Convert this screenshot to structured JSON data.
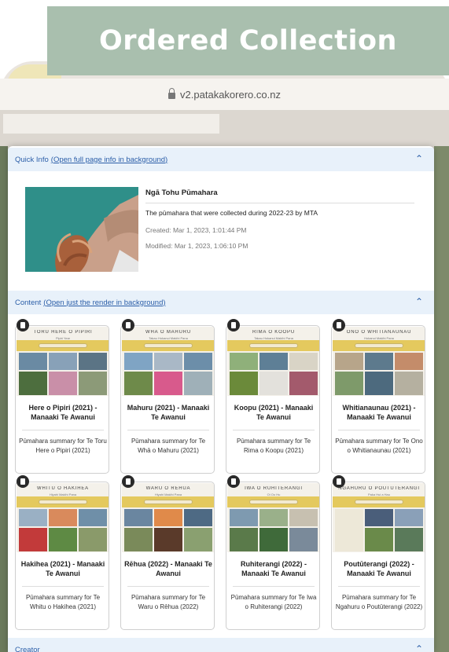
{
  "banner": {
    "title": "Ordered Collection"
  },
  "browser": {
    "url": "v2.patakakorero.co.nz"
  },
  "quick_info": {
    "header_label": "Quick Info",
    "header_link": "(Open full page info in background)",
    "title": "Ngā Tohu Pūmahara",
    "description": "The pūmahara that were collected during 2022-23 by MTA",
    "created": "Created: Mar 1, 2023, 1:01:44 PM",
    "modified": "Modified: Mar 1, 2023, 1:06:10 PM"
  },
  "content": {
    "header_label": "Content",
    "header_link": "(Open just the render in background)",
    "items": [
      {
        "thumb_title": "Toru Here o Pipiri",
        "thumb_sub": "Pipiri Year",
        "title": "Here o Pipiri (2021) - Manaaki Te Awanui",
        "description": "Pūmahara summary for Te Toru Here o Pipiri (2021)"
      },
      {
        "thumb_title": "Whā o Mahuru",
        "thumb_sub": "Takau Hokanui Makihi Pana",
        "title": "Mahuru (2021) - Manaaki Te Awanui",
        "description": "Pūmahara summary for Te Whā o Mahuru (2021)"
      },
      {
        "thumb_title": "Rima o Koopu",
        "thumb_sub": "Takau Hokanui Makihi Pana",
        "title": "Koopu (2021) - Manaaki Te Awanui",
        "description": "Pūmahara summary for Te Rima o Koopu (2021)"
      },
      {
        "thumb_title": "Ono o Whitianaunau",
        "thumb_sub": "Hokanui Makihi Pana",
        "title": "Whitianaunau (2021) - Manaaki Te Awanui",
        "description": "Pūmahara summary for Te Ono o Whitianaunau (2021)"
      },
      {
        "thumb_title": "Whitu o Hakihea",
        "thumb_sub": "Hiyahi Makihi Pana",
        "title": "Hakihea (2021) - Manaaki Te Awanui",
        "description": "Pūmahara summary for Te Whitu o Hakihea (2021)"
      },
      {
        "thumb_title": "Waru o Rēhua",
        "thumb_sub": "Hiyahi Makihi Pana",
        "title": "Rēhua (2022) - Manaaki Te Awanui",
        "description": "Pūmahara summary for Te Waru o Rēhua (2022)"
      },
      {
        "thumb_title": "Iwa o Ruhiterangi",
        "thumb_sub": "Oi Oo Hu",
        "title": "Ruhiterangi (2022) - Manaaki Te Awanui",
        "description": "Pūmahara summary for Te Iwa o Ruhiterangi (2022)"
      },
      {
        "thumb_title": "Ngahuru o Poutūterangi",
        "thumb_sub": "Paka Hui a Hau",
        "title": "Poutūterangi (2022) - Manaaki Te Awanui",
        "description": "Pūmahara summary for Te Ngahuru o Poutūterangi (2022)"
      }
    ]
  },
  "creator": {
    "header_label": "Creator"
  },
  "colors": {
    "accent": "#2b5ea8",
    "banner": "#a9bfae",
    "header_bg": "#e8f1fa",
    "thumb_band": "#e4c95e"
  },
  "icons": {
    "chevron": "chevron-up-icon",
    "doc": "document-icon",
    "lock": "lock-icon"
  }
}
